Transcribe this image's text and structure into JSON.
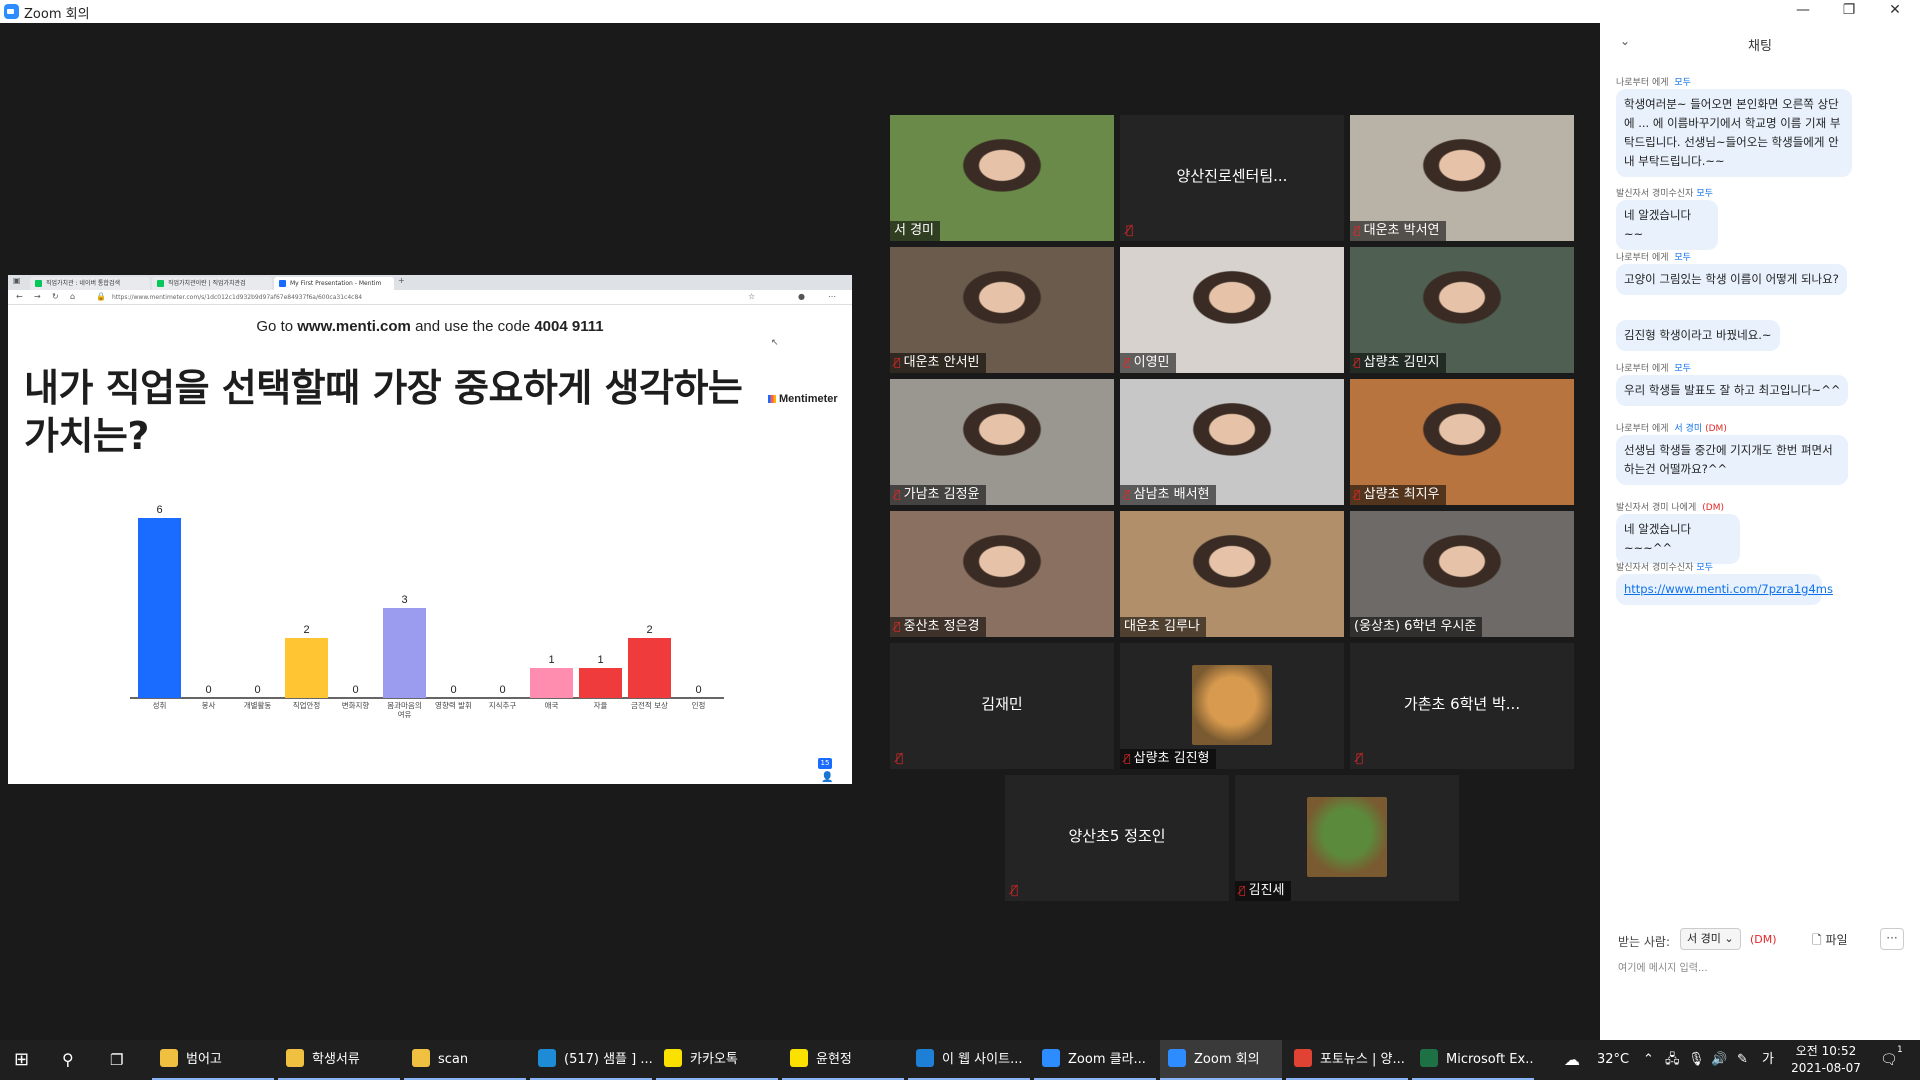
{
  "window": {
    "title": "Zoom 회의",
    "minimize": "—",
    "maximize": "❐",
    "close": "✕"
  },
  "share": {
    "browser_tabs": [
      "직업가치관 : 네이버 통합검색",
      "직업가치관이란 | 직업가치관검",
      "My First Presentation - Mentim"
    ],
    "url": "https://www.mentimeter.com/s/1dc012c1d932b9d97af67e84937f6a/600ca31c4c84",
    "instruction_prefix": "Go to",
    "instruction_site": "www.menti.com",
    "instruction_middle": "and use the code",
    "instruction_code": "4004 9111",
    "question": "내가 직업을 선택할때 가장 중요하게 생각하는 가치는?",
    "brand": "Mentimeter",
    "participants": "15",
    "cursor": "↖"
  },
  "chart_data": {
    "type": "bar",
    "title": "내가 직업을 선택할때 가장 중요하게 생각하는 가치는?",
    "categories": [
      "성취",
      "봉사",
      "개별활동",
      "직업안정",
      "변화지향",
      "몸과마음의 여유",
      "영향력 발휘",
      "지식추구",
      "애국",
      "자율",
      "금전적 보상",
      "인정"
    ],
    "values": [
      6,
      0,
      0,
      2,
      0,
      3,
      0,
      0,
      1,
      1,
      2,
      0
    ],
    "colors": [
      "#196cff",
      "#196cff",
      "#196cff",
      "#ffc533",
      "#ffc533",
      "#9b9bf0",
      "#9b9bf0",
      "#ff8db0",
      "#ff8db0",
      "#ef3b3b",
      "#ef3b3b",
      "#ffc533"
    ],
    "ylim": [
      0,
      6
    ]
  },
  "participants": [
    {
      "name": "서 경미",
      "video": true,
      "mic_muted": false,
      "bg": "#6a8a4a"
    },
    {
      "name": "양산진로센터팀...",
      "video": false,
      "mic_muted": true
    },
    {
      "name": "대운초 박서연",
      "video": true,
      "mic_muted": true,
      "bg": "#b9b2a6"
    },
    {
      "name": "대운초 안서빈",
      "video": true,
      "mic_muted": true,
      "bg": "#6b5b4d"
    },
    {
      "name": "이영민",
      "video": true,
      "mic_muted": true,
      "bg": "#d8d2cf"
    },
    {
      "name": "삽량초 김민지",
      "video": true,
      "mic_muted": true,
      "bg": "#4f5f52"
    },
    {
      "name": "가남초 김정윤",
      "video": true,
      "mic_muted": true,
      "bg": "#9a9690"
    },
    {
      "name": "삼남초 배서현",
      "video": true,
      "mic_muted": true,
      "bg": "#c7c7c7"
    },
    {
      "name": "삽량초 최지우",
      "video": true,
      "mic_muted": true,
      "bg": "#b8743f"
    },
    {
      "name": "중산초 정은경",
      "video": true,
      "mic_muted": true,
      "bg": "#8a7060"
    },
    {
      "name": "대운초 김루나",
      "video": true,
      "mic_muted": false,
      "bg": "#b08f6a"
    },
    {
      "name": "(웅상초) 6학년 우시준",
      "video": true,
      "mic_muted": false,
      "bg": "#6e6a68",
      "active": true
    },
    {
      "name": "김재민",
      "video": false,
      "mic_muted": true
    },
    {
      "name": "삽량초 김진형",
      "video": false,
      "mic_muted": true,
      "avatar": "#d79a4e"
    },
    {
      "name": "가촌초 6학년 박...",
      "video": false,
      "mic_muted": true
    },
    {
      "name": "양산초5 정조인",
      "video": false,
      "mic_muted": true
    },
    {
      "name": "김진세",
      "video": false,
      "mic_muted": true,
      "avatar": "#5c8a3c"
    }
  ],
  "chat": {
    "title": "채팅",
    "messages": [
      {
        "meta_a": "나로부터 에게 ",
        "meta_b": "모두",
        "meta_c": "",
        "text": "학생여러분~ 들어오면 본인화면 오른쪽 상단에 ... 에 이름바꾸기에서 학교명 이름 기재 부탁드립니다. 선생님~들어오는 학생들에게 안내 부탁드립니다.~~"
      },
      {
        "meta_a": "발신자서 경미수신자",
        "meta_b": "모두",
        "meta_c": "",
        "text": "네 알겠습니다~~"
      },
      {
        "meta_a": "나로부터 에게 ",
        "meta_b": "모두",
        "meta_c": "",
        "text": "고양이 그림있는 학생 이름이 어떻게 되나요?"
      },
      {
        "meta_a": "",
        "meta_b": "",
        "meta_c": "",
        "text": "김진형 학생이라고 바꿨네요.~"
      },
      {
        "meta_a": "나로부터 에게 ",
        "meta_b": "모두",
        "meta_c": "",
        "text": "우리 학생들 발표도 잘 하고 최고입니다~^^"
      },
      {
        "meta_a": "나로부터 에게 ",
        "meta_b": "서 경미",
        "meta_c": "(DM)",
        "text": "선생님 학생들 중간에 기지개도 한번 펴면서 하는건 어떨까요?^^"
      },
      {
        "meta_a": "발신자서 경미 나에게",
        "meta_b": "",
        "meta_c": "(DM)",
        "text": "네 알겠습니다~~~^^"
      },
      {
        "meta_a": "발신자서 경미수신자",
        "meta_b": "모두",
        "meta_c": "",
        "text": "https://www.menti.com/7pzra1g4ms"
      }
    ],
    "to_label": "받는 사람:",
    "recipient": "서 경미 ⌄",
    "dm": "(DM)",
    "file": "🗋 파일",
    "more": "···",
    "input_placeholder": "여기에 메시지 입력..."
  },
  "taskbar": {
    "items": [
      {
        "label": "범어고",
        "color": "#f0c040"
      },
      {
        "label": "학생서류",
        "color": "#f0c040"
      },
      {
        "label": "scan",
        "color": "#f0c040"
      },
      {
        "label": "(517) 샘플 ] ...",
        "color": "#1d8bd6"
      },
      {
        "label": "카카오톡",
        "color": "#fae100"
      },
      {
        "label": "윤현정",
        "color": "#fae100"
      },
      {
        "label": "이 웹 사이트...",
        "color": "#1e7fd6"
      },
      {
        "label": "Zoom 클라...",
        "color": "#2d8cff"
      },
      {
        "label": "Zoom 회의",
        "color": "#2d8cff"
      },
      {
        "label": "포토뉴스 | 양...",
        "color": "#e04333"
      },
      {
        "label": "Microsoft Ex...",
        "color": "#1e7145"
      }
    ],
    "temp": "32°C",
    "lang": "가",
    "time": "오전 10:52",
    "date": "2021-08-07",
    "notif": "1"
  }
}
